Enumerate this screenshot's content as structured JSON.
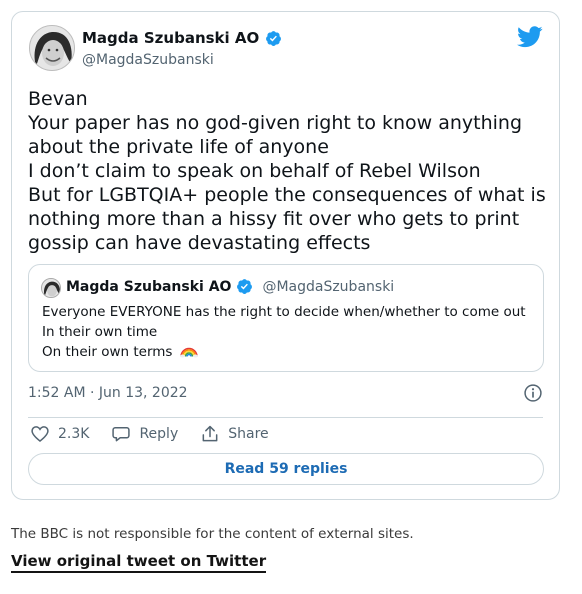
{
  "tweet": {
    "author_name": "Magda Szubanski AO",
    "author_handle": "@MagdaSzubanski",
    "body_lines": [
      "Bevan",
      "Your paper has no god-given right to know anything",
      "about the private life of anyone",
      "I don’t claim to speak on behalf of Rebel Wilson",
      "But for LGBTQIA+ people the consequences of what is",
      "nothing more than a hissy fit over who gets to print",
      "gossip can have devastating effects"
    ],
    "quote": {
      "author_name": "Magda Szubanski AO",
      "author_handle": "@MagdaSzubanski",
      "lines": [
        "Everyone EVERYONE has the right to decide when/whether to come out",
        "In their own time",
        "On their own terms"
      ]
    },
    "timestamp": "1:52 AM · Jun 13, 2022",
    "likes": "2.3K",
    "reply_label": "Reply",
    "share_label": "Share",
    "read_replies_label": "Read 59 replies"
  },
  "footer": {
    "disclaimer": "The BBC is not responsible for the content of external sites.",
    "view_link": "View original tweet on Twitter"
  },
  "colors": {
    "verified": "#1d9bf0",
    "twitter_blue": "#1d9bf0",
    "link_blue": "#1d6bb4",
    "border": "#cfd9de",
    "muted": "#536471"
  }
}
